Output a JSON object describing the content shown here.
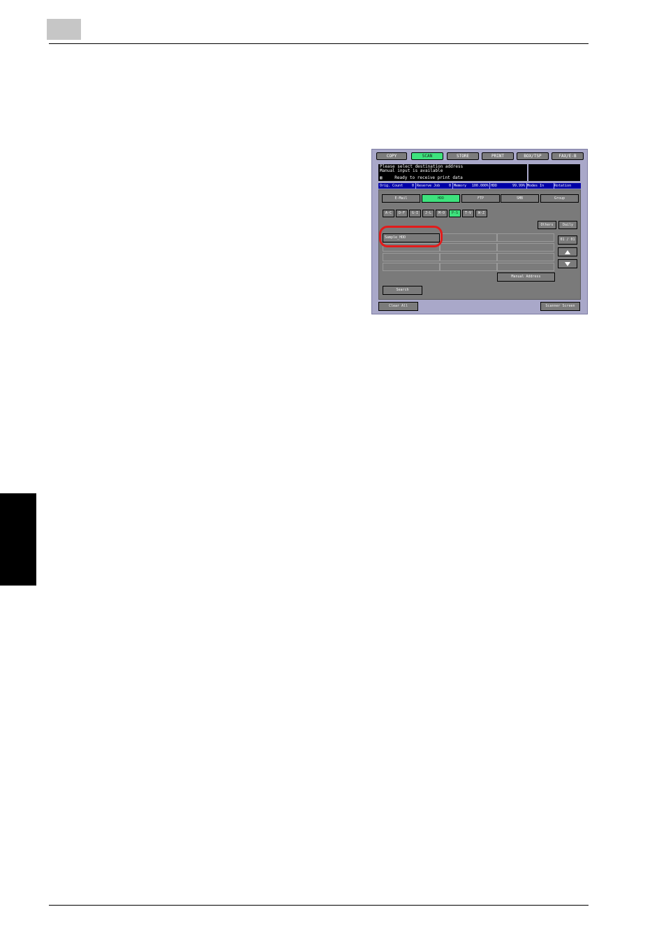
{
  "screen": {
    "mode_tabs": [
      "COPY",
      "SCAN",
      "STORE",
      "PRINT",
      "BOX/TSP",
      "FAX/E-B"
    ],
    "active_mode_tab": "SCAN",
    "message_line1": "Please select destination address",
    "message_line2": "Manual input is available",
    "message_line3": "Ready to receive print data",
    "status": {
      "orig_count": "Orig. Count",
      "orig_count_value": "0",
      "reserve_job": "Reserve Job",
      "reserve_job_value": "0",
      "memory": "Memory",
      "memory_value": "100.000%",
      "hdd": "HDD",
      "hdd_value": "99.99%",
      "modes": "Modes In",
      "rotation": "Rotation"
    },
    "dest_tabs": [
      "E-Mail",
      "HDD",
      "FTP",
      "SMB",
      "Group"
    ],
    "active_dest_tab": "HDD",
    "alpha_tabs": [
      "A-C",
      "D-F",
      "G-I",
      "J-L",
      "M-O",
      "P-S",
      "T-V",
      "W-Z"
    ],
    "active_alpha_tab": "P-S",
    "others_button": "Others",
    "daily_button": "Daily",
    "selected_entry": "Sample_HDD",
    "page_indicator": "01 / 01",
    "manual_address_button": "Manual Address",
    "search_button": "Search",
    "clear_all_button": "Clear All",
    "scanner_screen_button": "Scanner Screen"
  }
}
